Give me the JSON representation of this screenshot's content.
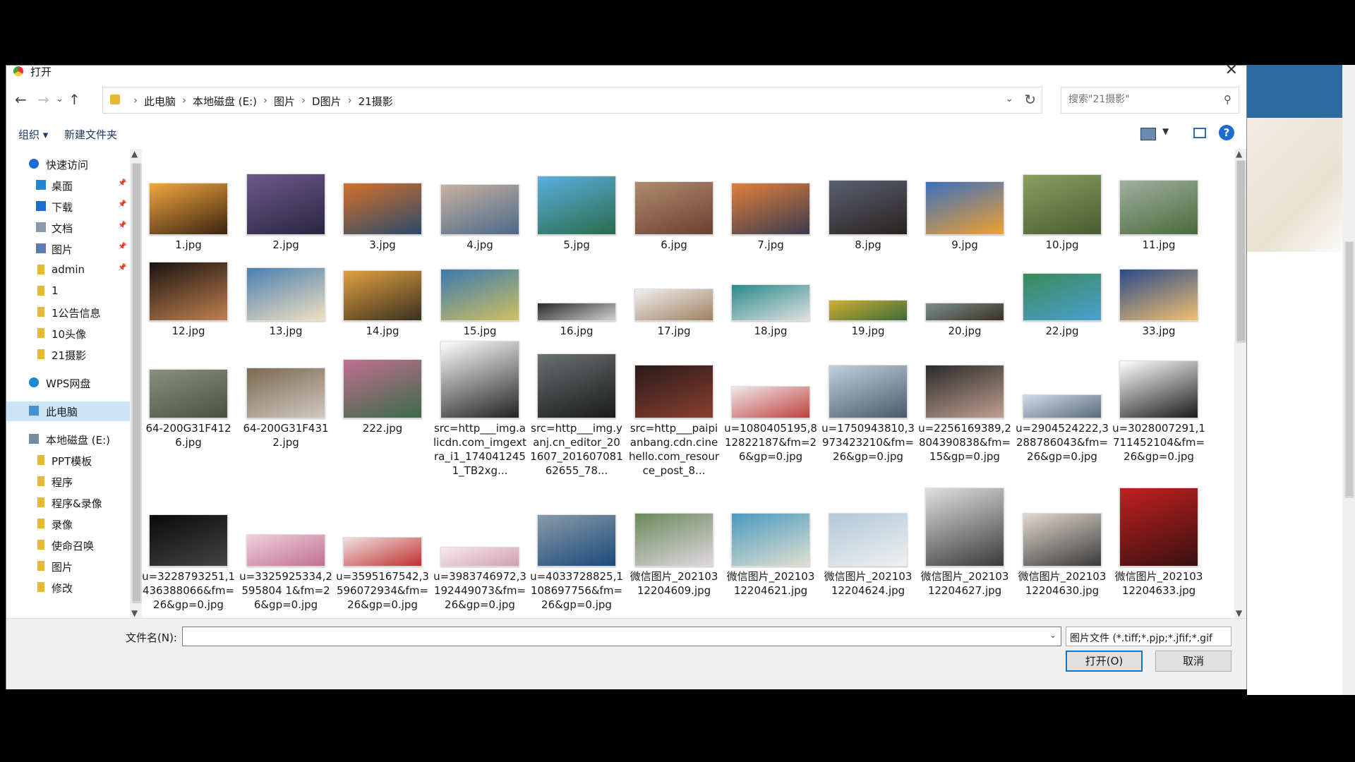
{
  "window": {
    "title": "打开"
  },
  "breadcrumbs": [
    "此电脑",
    "本地磁盘 (E:)",
    "图片",
    "D图片",
    "21摄影"
  ],
  "search": {
    "placeholder": "搜索\"21摄影\""
  },
  "toolbar": {
    "organize": "组织 ▾",
    "new_folder": "新建文件夹",
    "help": "?"
  },
  "sidebar": [
    {
      "label": "快速访问",
      "icon": "star-icon",
      "color": "#1e6bd4",
      "indent": 0,
      "pinned": false
    },
    {
      "label": "桌面",
      "icon": "desktop-icon",
      "color": "#1e88d4",
      "indent": 1,
      "pinned": true
    },
    {
      "label": "下载",
      "icon": "download-icon",
      "color": "#1e6bd4",
      "indent": 1,
      "pinned": true
    },
    {
      "label": "文档",
      "icon": "document-icon",
      "color": "#8899aa",
      "indent": 1,
      "pinned": true
    },
    {
      "label": "图片",
      "icon": "pictures-icon",
      "color": "#5a7ab0",
      "indent": 1,
      "pinned": true
    },
    {
      "label": "admin",
      "icon": "folder-icon",
      "color": "#e8b830",
      "indent": 1,
      "pinned": true
    },
    {
      "label": "1",
      "icon": "folder-icon",
      "color": "#e8b830",
      "indent": 1,
      "pinned": false
    },
    {
      "label": "1公告信息",
      "icon": "folder-icon",
      "color": "#e8b830",
      "indent": 1,
      "pinned": false
    },
    {
      "label": "10头像",
      "icon": "folder-icon",
      "color": "#e8b830",
      "indent": 1,
      "pinned": false
    },
    {
      "label": "21摄影",
      "icon": "folder-icon",
      "color": "#e8b830",
      "indent": 1,
      "pinned": false
    },
    {
      "label": "WPS网盘",
      "icon": "cloud-icon",
      "color": "#1e88d4",
      "indent": 0,
      "pinned": false
    },
    {
      "label": "此电脑",
      "icon": "computer-icon",
      "color": "#4a90d0",
      "indent": 0,
      "pinned": false,
      "selected": true
    },
    {
      "label": "本地磁盘 (E:)",
      "icon": "drive-icon",
      "color": "#7a8a9a",
      "indent": 0,
      "pinned": false
    },
    {
      "label": "PPT模板",
      "icon": "folder-icon",
      "color": "#e8b830",
      "indent": 1,
      "pinned": false
    },
    {
      "label": "程序",
      "icon": "folder-icon",
      "color": "#e8b830",
      "indent": 1,
      "pinned": false
    },
    {
      "label": "程序&录像",
      "icon": "folder-icon",
      "color": "#e8b830",
      "indent": 1,
      "pinned": false
    },
    {
      "label": "录像",
      "icon": "folder-icon",
      "color": "#e8b830",
      "indent": 1,
      "pinned": false
    },
    {
      "label": "使命召唤",
      "icon": "folder-icon",
      "color": "#e8b830",
      "indent": 1,
      "pinned": false
    },
    {
      "label": "图片",
      "icon": "folder-icon",
      "color": "#e8b830",
      "indent": 1,
      "pinned": false
    },
    {
      "label": "修改",
      "icon": "folder-icon",
      "color": "#e8b830",
      "indent": 1,
      "pinned": false
    }
  ],
  "files": [
    {
      "name": "1.jpg",
      "colors": [
        "#f2a640",
        "#3a2310"
      ]
    },
    {
      "name": "2.jpg",
      "colors": [
        "#6a5a8a",
        "#2b2540"
      ]
    },
    {
      "name": "3.jpg",
      "colors": [
        "#d4702a",
        "#2a4a6a"
      ]
    },
    {
      "name": "4.jpg",
      "colors": [
        "#c8b0a0",
        "#4a6a8a"
      ]
    },
    {
      "name": "5.jpg",
      "colors": [
        "#5ab0e0",
        "#2a6a4a"
      ]
    },
    {
      "name": "6.jpg",
      "colors": [
        "#b08a70",
        "#6a4030"
      ]
    },
    {
      "name": "7.jpg",
      "colors": [
        "#e0803a",
        "#3a3a50"
      ]
    },
    {
      "name": "8.jpg",
      "colors": [
        "#5a6070",
        "#2a2220"
      ]
    },
    {
      "name": "9.jpg",
      "colors": [
        "#3a70c0",
        "#f0a030"
      ]
    },
    {
      "name": "10.jpg",
      "colors": [
        "#8aa060",
        "#4a5a30"
      ]
    },
    {
      "name": "11.jpg",
      "colors": [
        "#a0b0a0",
        "#4a6a3a"
      ]
    },
    {
      "name": "12.jpg",
      "colors": [
        "#1a1410",
        "#c08050"
      ]
    },
    {
      "name": "13.jpg",
      "colors": [
        "#4a80b0",
        "#f0e0c0"
      ]
    },
    {
      "name": "14.jpg",
      "colors": [
        "#e0a040",
        "#3a3020"
      ]
    },
    {
      "name": "15.jpg",
      "colors": [
        "#3a7ab0",
        "#d0c060"
      ]
    },
    {
      "name": "16.jpg",
      "colors": [
        "#2a2a2a",
        "#d0d0d0"
      ]
    },
    {
      "name": "17.jpg",
      "colors": [
        "#f0f0f0",
        "#a08060"
      ]
    },
    {
      "name": "18.jpg",
      "colors": [
        "#2a8a8a",
        "#e0e0e0"
      ]
    },
    {
      "name": "19.jpg",
      "colors": [
        "#d0b030",
        "#3a6a3a"
      ]
    },
    {
      "name": "20.jpg",
      "colors": [
        "#7a9090",
        "#3a3020"
      ]
    },
    {
      "name": "22.jpg",
      "colors": [
        "#3a8a5a",
        "#4aa0d0"
      ]
    },
    {
      "name": "33.jpg",
      "colors": [
        "#2a4a8a",
        "#f0c070"
      ]
    },
    {
      "name": "64-200G31F4126.jpg",
      "colors": [
        "#8a9080",
        "#4a5040"
      ]
    },
    {
      "name": "64-200G31F4312.jpg",
      "colors": [
        "#7a6a50",
        "#d0c8c0"
      ]
    },
    {
      "name": "222.jpg",
      "colors": [
        "#c07090",
        "#3a6a4a"
      ]
    },
    {
      "name": "src=http___img.alicdn.com_imgextra_i1_1740412451_TB2xg...",
      "colors": [
        "#ffffff",
        "#222222"
      ]
    },
    {
      "name": "src=http___img.yanj.cn_editor_201607_20160708162655_78...",
      "colors": [
        "#6a7070",
        "#1a1a1a"
      ]
    },
    {
      "name": "src=http___paipianbang.cdn.cinehello.com_resource_post_8...",
      "colors": [
        "#2a1a1a",
        "#8a4030"
      ]
    },
    {
      "name": "u=1080405195,812822187&fm=26&gp=0.jpg",
      "colors": [
        "#f0e8e8",
        "#c04040"
      ]
    },
    {
      "name": "u=1750943810,3973423210&fm=26&gp=0.jpg",
      "colors": [
        "#c0d0e0",
        "#4a5a6a"
      ]
    },
    {
      "name": "u=2256169389,2804390838&fm=15&gp=0.jpg",
      "colors": [
        "#2a2a2a",
        "#c0a090"
      ]
    },
    {
      "name": "u=2904524222,3288786043&fm=26&gp=0.jpg",
      "colors": [
        "#d0dce8",
        "#5a6a7a"
      ]
    },
    {
      "name": "u=3028007291,1711452104&fm=26&gp=0.jpg",
      "colors": [
        "#ffffff",
        "#1a1a1a"
      ]
    },
    {
      "name": "u=3228793251,1436388066&fm=26&gp=0.jpg",
      "colors": [
        "#0a0a0a",
        "#444444"
      ]
    },
    {
      "name": "u=3325925334,2595804 1&fm=26&gp=0.jpg",
      "colors": [
        "#f0d0e0",
        "#c07090"
      ]
    },
    {
      "name": "u=3595167542,3596072934&fm=26&gp=0.jpg",
      "colors": [
        "#f0e0e0",
        "#c03030"
      ]
    },
    {
      "name": "u=3983746972,3192449073&fm=26&gp=0.jpg",
      "colors": [
        "#f8e8ec",
        "#d0a0b0"
      ]
    },
    {
      "name": "u=4033728825,1108697756&fm=26&gp=0.jpg",
      "colors": [
        "#8a9aa8",
        "#1a4a7a"
      ]
    },
    {
      "name": "微信图片_20210312204609.jpg",
      "colors": [
        "#6a8a5a",
        "#e0d8e0"
      ]
    },
    {
      "name": "微信图片_20210312204621.jpg",
      "colors": [
        "#4a9ac0",
        "#e0e0d0"
      ]
    },
    {
      "name": "微信图片_20210312204624.jpg",
      "colors": [
        "#b0c8d8",
        "#f0f0f0"
      ]
    },
    {
      "name": "微信图片_20210312204627.jpg",
      "colors": [
        "#e0e0e0",
        "#3a3a3a"
      ]
    },
    {
      "name": "微信图片_20210312204630.jpg",
      "colors": [
        "#e0d8d0",
        "#3a3a3a"
      ]
    },
    {
      "name": "微信图片_20210312204633.jpg",
      "colors": [
        "#c02020",
        "#3a1010"
      ]
    }
  ],
  "bottom": {
    "filename_label": "文件名(N):",
    "filename_value": "",
    "filetype": "图片文件 (*.tiff;*.pjp;*.jfif;*.gif",
    "open": "打开(O)",
    "cancel": "取消"
  }
}
